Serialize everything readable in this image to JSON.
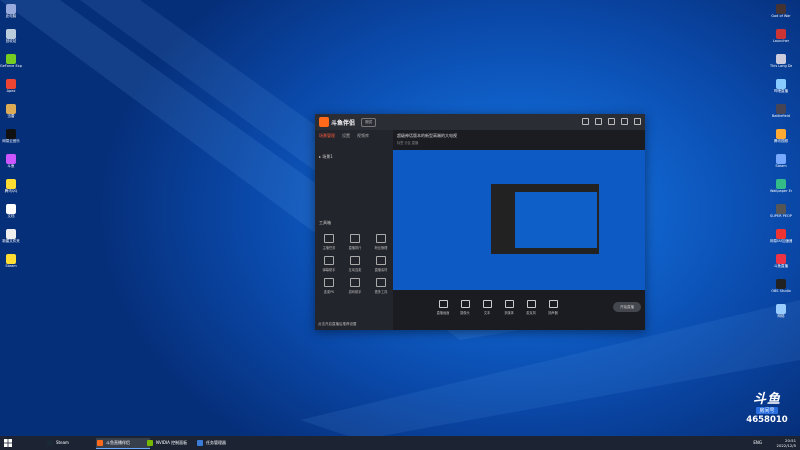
{
  "desktop": {
    "left_icons": [
      {
        "label": "此电脑",
        "color": "#9ad"
      },
      {
        "label": "回收站",
        "color": "#bcd"
      },
      {
        "label": "GeForce Experience",
        "color": "#7c2"
      },
      {
        "label": "Apex",
        "color": "#e43"
      },
      {
        "label": "迅雷",
        "color": "#da5"
      },
      {
        "label": "网易云音乐",
        "color": "#111"
      },
      {
        "label": "斗鱼",
        "color": "#c5f"
      },
      {
        "label": "腾讯QQ",
        "color": "#fd3"
      },
      {
        "label": "文档",
        "color": "#fff"
      },
      {
        "label": "新建文件夹",
        "color": "#eee"
      },
      {
        "label": "Steam",
        "color": "#fd3"
      }
    ],
    "right_icons": [
      {
        "label": "God of War",
        "color": "#433"
      },
      {
        "label": "Launcher",
        "color": "#c33"
      },
      {
        "label": "This Long Dark",
        "color": "#ccd"
      },
      {
        "label": "哔哩直播",
        "color": "#8cf"
      },
      {
        "label": "Battlefield",
        "color": "#445"
      },
      {
        "label": "腾讯视频",
        "color": "#fa3"
      },
      {
        "label": "Steam",
        "color": "#7af"
      },
      {
        "label": "Wallpaper Engine",
        "color": "#3b8"
      },
      {
        "label": "SUPER PEOPLE",
        "color": "#555"
      },
      {
        "label": "网易UU加速器",
        "color": "#e33"
      },
      {
        "label": "斗鱼直播",
        "color": "#e34"
      },
      {
        "label": "OBS Studio",
        "color": "#222"
      },
      {
        "label": "网络",
        "color": "#9cf"
      }
    ]
  },
  "app": {
    "name": "斗鱼伴侣",
    "version": "测试",
    "tabs": [
      "场景管理",
      "设置",
      "视频库"
    ],
    "scene_label": "场景1",
    "tools_header": "工具箱",
    "tools": [
      "主播任务",
      "直播排行",
      "粉丝管理",
      "弹幕助手",
      "互动连麦",
      "直播素材",
      "连麦PK",
      "游戏助手",
      "更多工具"
    ],
    "footer_tip": "点击开启直播后推荐设置",
    "room_title": "超级神话版本的新型高端的大电视",
    "room_sub": "标签  分区  直播",
    "bottom_buttons": [
      "直播画面",
      "摄像头",
      "文本",
      "多媒体",
      "麦克风",
      "扬声器"
    ],
    "go_live": "开始直播"
  },
  "taskbar": {
    "items": [
      {
        "label": "Steam",
        "color": "#1b2838"
      },
      {
        "label": "斗鱼直播伴侣",
        "color": "#ff6a1a",
        "active": true
      },
      {
        "label": "NVIDIA 控制面板",
        "color": "#76b900"
      },
      {
        "label": "任务管理器",
        "color": "#3a7bd5"
      }
    ],
    "lang": "ENG",
    "time": "20:51",
    "date": "2022/12/5"
  },
  "watermark": {
    "logo": "斗鱼",
    "badge": "房间号",
    "room_number": "4658010"
  }
}
